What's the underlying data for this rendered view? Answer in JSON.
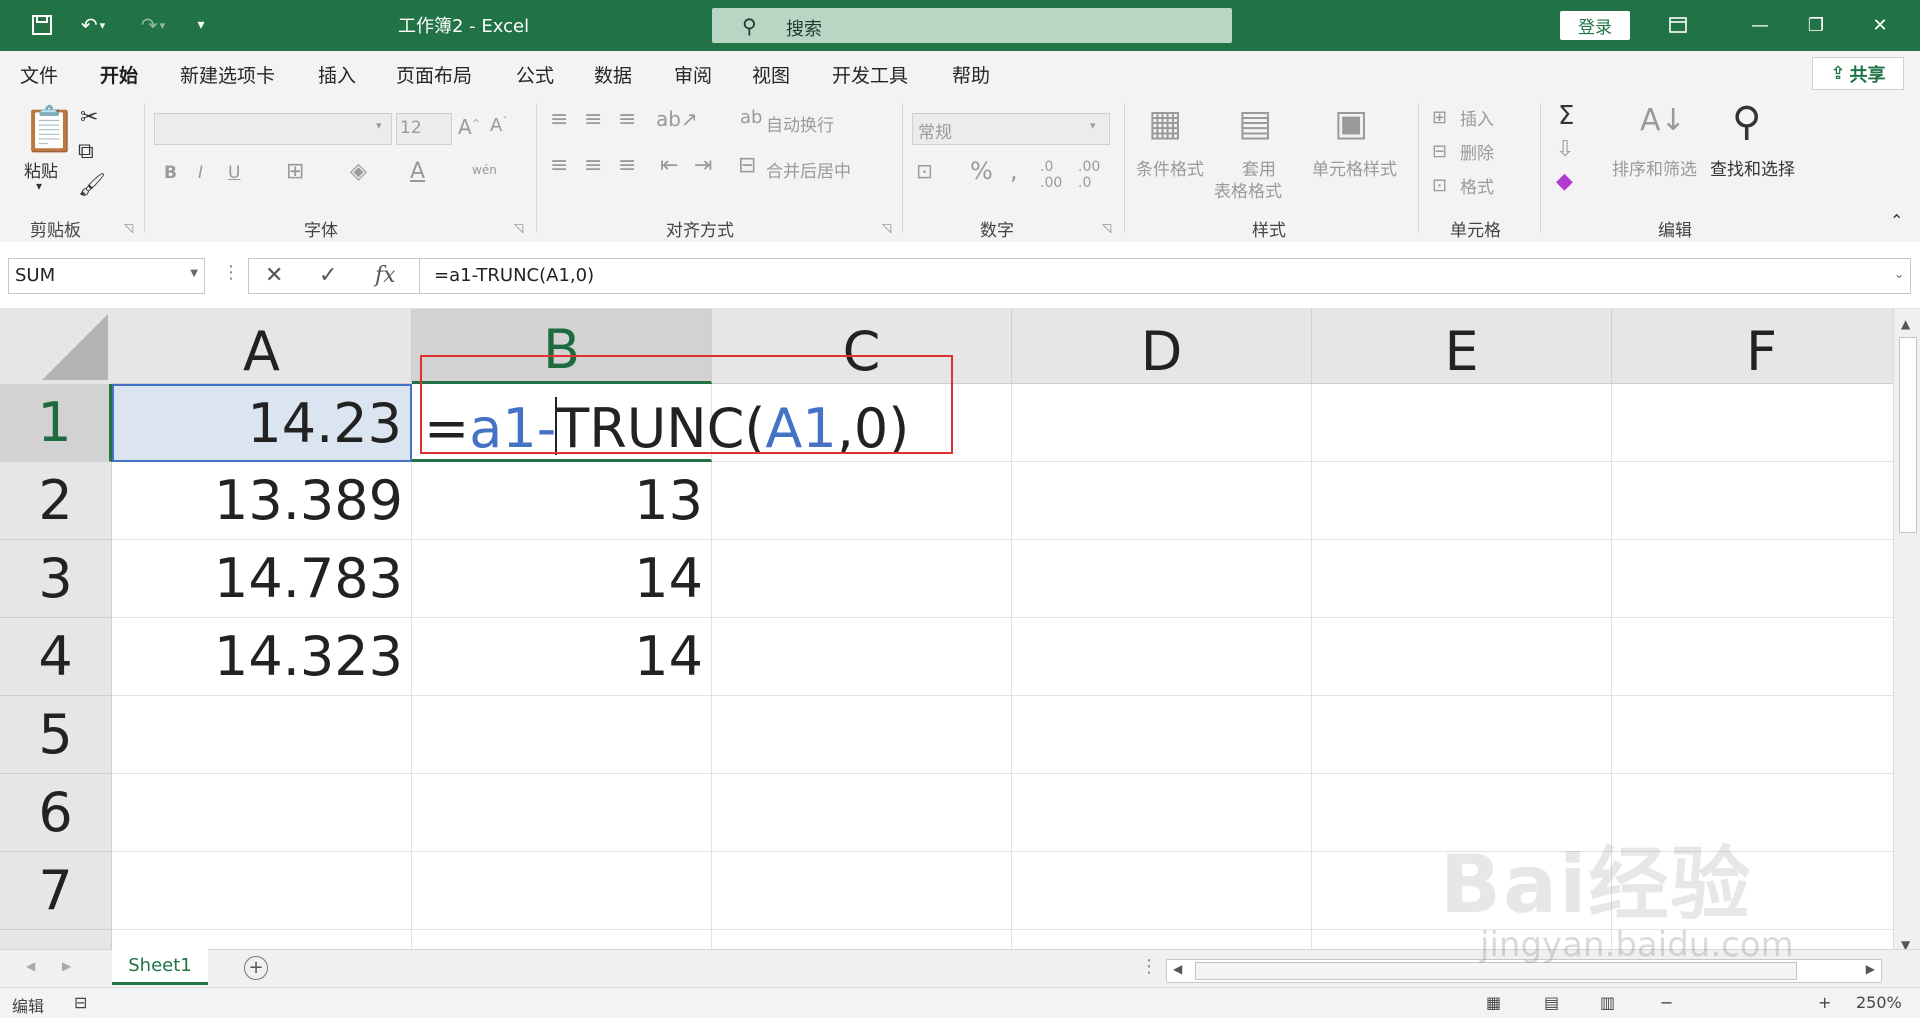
{
  "title": "工作簿2  -  Excel",
  "search_label": "搜索",
  "login_label": "登录",
  "menu_tabs": [
    "文件",
    "开始",
    "新建选项卡",
    "插入",
    "页面布局",
    "公式",
    "数据",
    "审阅",
    "视图",
    "开发工具",
    "帮助"
  ],
  "share_label": "共享",
  "ribbon": {
    "paste": "粘贴",
    "font_size": "12",
    "wrap_text": "自动换行",
    "merge_center": "合并后居中",
    "number_format": "常规",
    "cond_format": "条件格式",
    "table_format_1": "套用",
    "table_format_2": "表格格式",
    "cell_styles": "单元格样式",
    "insert": "插入",
    "delete": "删除",
    "format": "格式",
    "sort_filter": "排序和筛选",
    "find_select": "查找和选择",
    "groups": {
      "clipboard": "剪贴板",
      "font": "字体",
      "alignment": "对齐方式",
      "number": "数字",
      "styles": "样式",
      "cells": "单元格",
      "editing": "编辑"
    }
  },
  "name_box": "SUM",
  "formula": "=a1-TRUNC(A1,0)",
  "columns": [
    "A",
    "B",
    "C",
    "D",
    "E",
    "F"
  ],
  "rows": [
    "1",
    "2",
    "3",
    "4",
    "5",
    "6",
    "7"
  ],
  "cells": {
    "A1": "14.23",
    "A2": "13.389",
    "A3": "14.783",
    "A4": "14.323",
    "B2": "13",
    "B3": "14",
    "B4": "14"
  },
  "edit": {
    "eq": "=",
    "ref1": "a1",
    "minus": "-",
    "func": "TRUNC(",
    "ref2": "A1",
    "tail": ",0)"
  },
  "sheet_tab": "Sheet1",
  "add_sheet": "+",
  "status_mode": "编辑",
  "zoom": "250%",
  "watermark": "Bai经验",
  "watermark_url": "jingyan.baidu.com",
  "colors": {
    "accent": "#217346",
    "ref_blue": "#4472c4",
    "highlight_red": "#e03030"
  }
}
